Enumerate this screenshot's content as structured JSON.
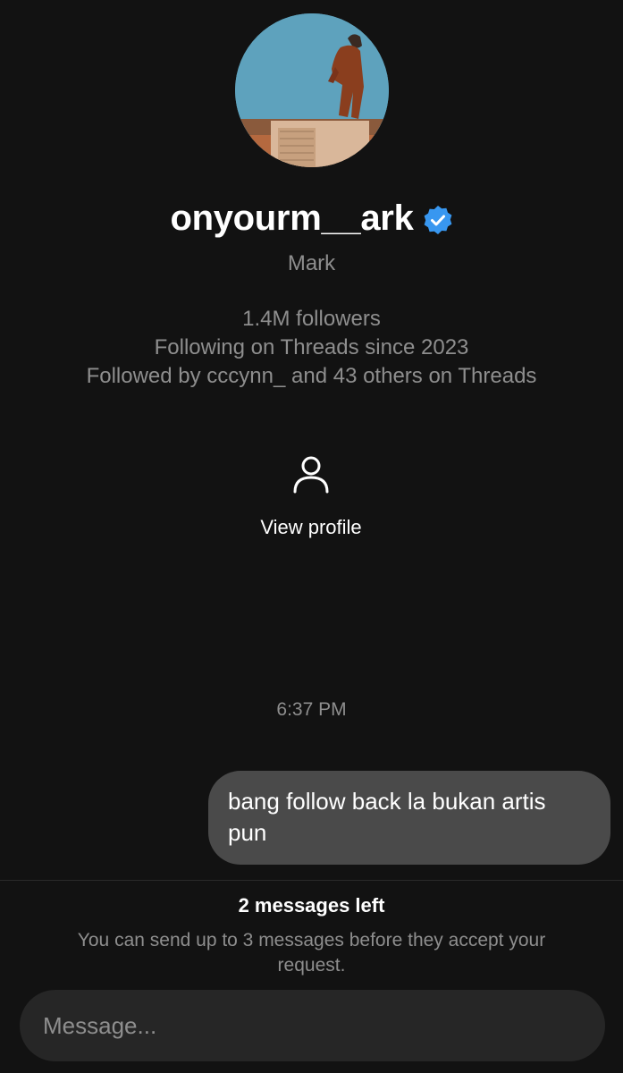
{
  "profile": {
    "username": "onyourm__ark",
    "display_name": "Mark",
    "verified_icon": "verified-badge",
    "followers": "1.4M followers",
    "following_since": "Following on Threads since 2023",
    "followed_by": "Followed by cccynn_ and 43 others on Threads",
    "view_profile_label": "View profile",
    "view_profile_icon": "person-icon"
  },
  "conversation": {
    "timestamp": "6:37 PM",
    "messages": [
      {
        "from": "me",
        "text": "bang follow back la bukan artis pun"
      }
    ]
  },
  "request_limit": {
    "title": "2 messages left",
    "note": "You can send up to 3 messages before they accept your request."
  },
  "composer": {
    "placeholder": "Message..."
  },
  "colors": {
    "background": "#121212",
    "secondary_text": "#8e8e8e",
    "bubble": "#4a4a4a",
    "verified_blue": "#3897f0"
  }
}
